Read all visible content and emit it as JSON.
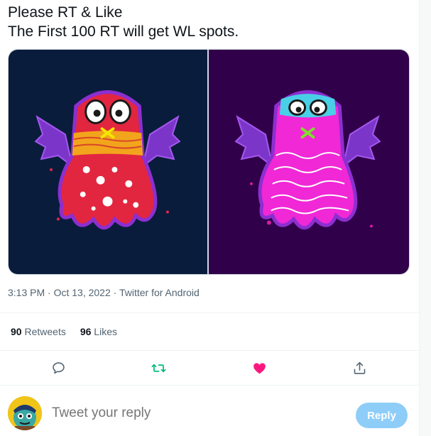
{
  "tweet": {
    "text_lines": [
      "Please RT & Like",
      "The First 100 RT will get WL spots."
    ],
    "time": "3:13 PM",
    "date": "Oct 13, 2022",
    "source": "Twitter for Android",
    "separator": "·"
  },
  "media": {
    "left_background": "#0a1c3c",
    "right_background": "#31004a",
    "left_image": "red-ghost-monster-with-bat-wings",
    "right_image": "pink-ghost-monster-with-bat-wings"
  },
  "stats": {
    "retweets_count": "90",
    "retweets_label": "Retweets",
    "likes_count": "96",
    "likes_label": "Likes"
  },
  "actions": {
    "reply_icon": "comment-icon",
    "retweet_icon": "retweet-icon",
    "like_icon": "heart-icon",
    "share_icon": "share-icon",
    "retweet_color": "#00ba7c",
    "like_color": "#f91880"
  },
  "reply": {
    "placeholder": "Tweet your reply",
    "button_label": "Reply",
    "button_color": "#8ecdf8"
  }
}
